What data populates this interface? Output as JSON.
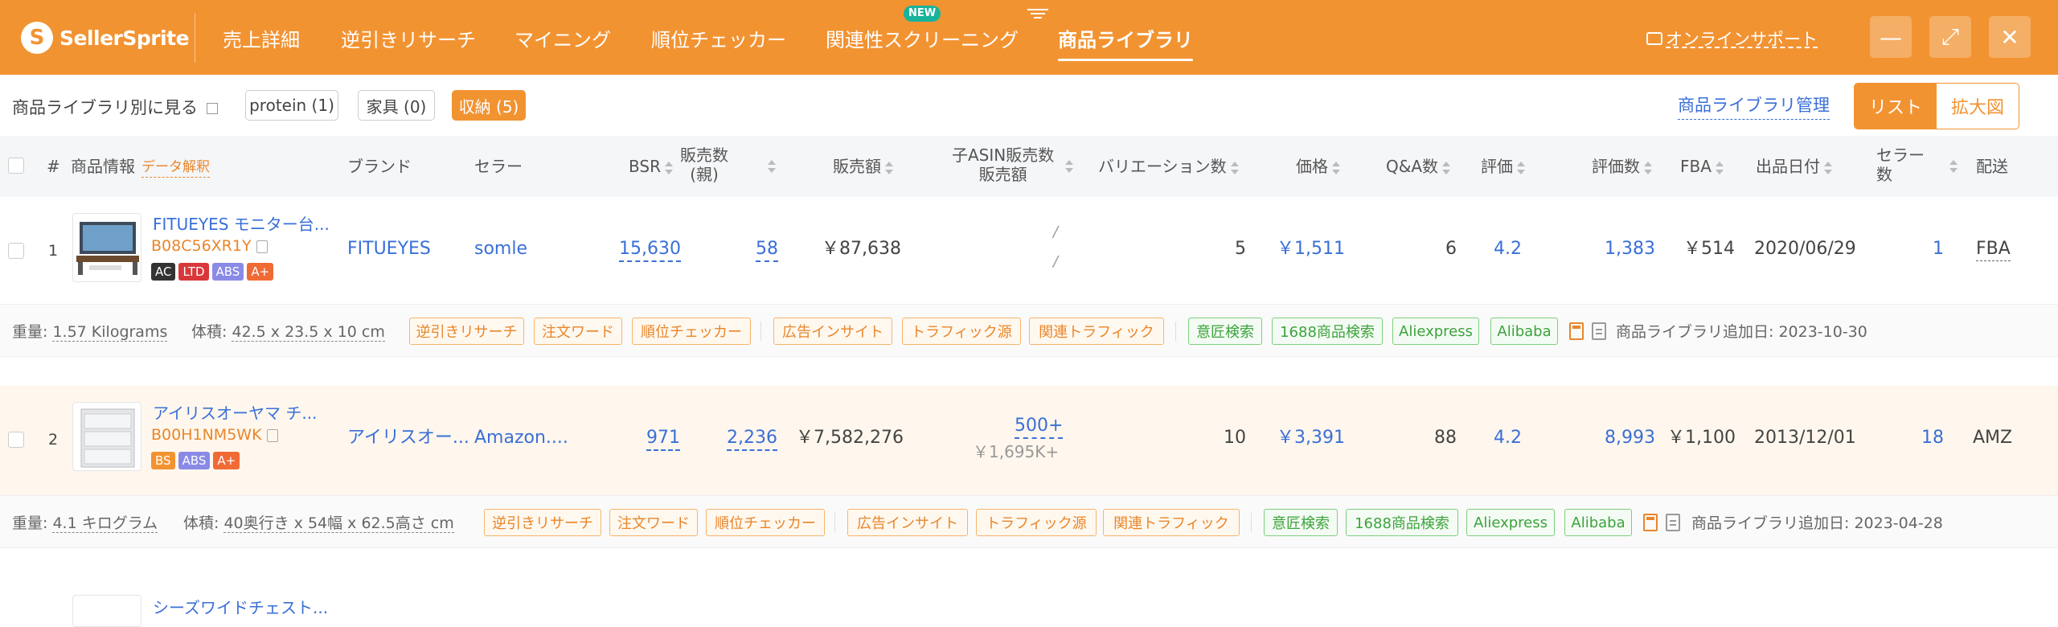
{
  "app": {
    "name": "SellerSprite"
  },
  "nav": {
    "tabs": [
      "売上詳細",
      "逆引きリサーチ",
      "マイニング",
      "順位チェッカー",
      "関連性スクリーニング",
      "商品ライブラリ"
    ],
    "active_tab": "商品ライブラリ",
    "new_badge": "NEW",
    "support": "オンラインサポート"
  },
  "window": {
    "minimize": "—",
    "maximize": "⤢",
    "close": "✕"
  },
  "filter": {
    "label": "商品ライブラリ別に見る",
    "chips": [
      "protein (1)",
      "家具 (0)",
      "収納 (5)"
    ],
    "active_chip": "収納 (5)",
    "manage": "商品ライブラリ管理",
    "view_list": "リスト",
    "view_large": "拡大図"
  },
  "table": {
    "headers": {
      "index": "#",
      "product": "商品情報",
      "data_help": "データ解釈",
      "brand": "ブランド",
      "seller": "セラー",
      "bsr": "BSR",
      "sales_parent": "販売数",
      "sales_parent_sub": "(親)",
      "revenue": "販売額",
      "child_asin": "子ASIN販売数",
      "child_asin_sub": "販売額",
      "variations": "バリエーション数",
      "price": "価格",
      "qa": "Q&A数",
      "rating": "評価",
      "reviews": "評価数",
      "fba": "FBA",
      "listed": "出品日付",
      "seller_count": "セラー",
      "seller_count_sub": "数",
      "delivery": "配送"
    },
    "rows": [
      {
        "index": "1",
        "title": "FITUEYES モニター台...",
        "asin": "B08C56XR1Y",
        "tags": [
          "AC",
          "LTD",
          "ABS",
          "A+"
        ],
        "brand": "FITUEYES",
        "seller": "somle",
        "bsr": "15,630",
        "sales": "58",
        "revenue": "￥87,638",
        "child_sales": "/",
        "child_revenue": "/",
        "variations": "5",
        "price": "￥1,511",
        "qa": "6",
        "rating": "4.2",
        "reviews": "1,383",
        "fba": "￥514",
        "listed": "2020/06/29",
        "sellers": "1",
        "delivery": "FBA",
        "meta": {
          "weight_label": "重量:",
          "weight": "1.57 Kilograms",
          "size_label": "体積:",
          "size": "42.5 x 23.5 x 10 cm",
          "added": "商品ライブラリ追加日: 2023-10-30"
        }
      },
      {
        "index": "2",
        "title": "アイリスオーヤマ チ...",
        "asin": "B00H1NM5WK",
        "tags": [
          "BS",
          "ABS",
          "A+"
        ],
        "brand": "アイリスオー...",
        "seller": "Amazon....",
        "bsr": "971",
        "sales": "2,236",
        "revenue": "￥7,582,276",
        "child_sales": "500+",
        "child_revenue": "￥1,695K+",
        "variations": "10",
        "price": "￥3,391",
        "qa": "88",
        "rating": "4.2",
        "reviews": "8,993",
        "fba": "￥1,100",
        "listed": "2013/12/01",
        "sellers": "18",
        "delivery": "AMZ",
        "meta": {
          "weight_label": "重量:",
          "weight": "4.1 キログラム",
          "size_label": "体積:",
          "size": "40奥行き x 54幅 x 62.5高さ cm",
          "added": "商品ライブラリ追加日: 2023-04-28"
        }
      },
      {
        "title": "シーズワイドチェスト..."
      }
    ],
    "tools_orange": [
      "逆引きリサーチ",
      "注文ワード",
      "順位チェッカー",
      "広告インサイト",
      "トラフィック源",
      "関連トラフィック"
    ],
    "tools_green": [
      "意匠検索",
      "1688商品検索",
      "Aliexpress",
      "Alibaba"
    ]
  },
  "colors": {
    "brand_orange": "#f29332",
    "link_blue": "#3a6fd8",
    "green": "#3ca33c"
  }
}
